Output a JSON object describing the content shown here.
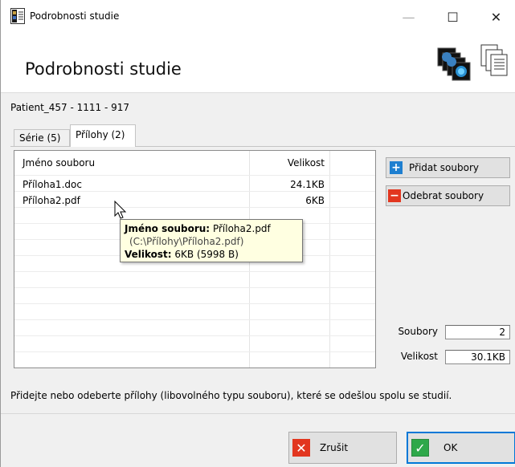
{
  "titlebar": {
    "title": "Podrobnosti studie",
    "minimize_glyph": "—",
    "maximize_glyph": "☐",
    "close_glyph": "✕"
  },
  "header": {
    "title": "Podrobnosti studie",
    "icons": [
      "image-stack-icon",
      "document-stack-icon"
    ]
  },
  "patient_label": "Patient_457 - 1111 - 917",
  "tabs": [
    {
      "label": "Série (5)",
      "active": false
    },
    {
      "label": "Přílohy (2)",
      "active": true
    }
  ],
  "file_table": {
    "columns": [
      "Jméno souboru",
      "Velikost"
    ],
    "rows": [
      {
        "name": "Příloha1.doc",
        "size": "24.1KB"
      },
      {
        "name": "Příloha2.pdf",
        "size": "6KB"
      }
    ]
  },
  "actions": {
    "add_label": "Přidat soubory",
    "remove_label": "Odebrat soubory"
  },
  "summary": {
    "files_label": "Soubory",
    "files_value": "2",
    "size_label": "Velikost",
    "size_value": "30.1KB"
  },
  "hint": "Přidejte nebo odeberte přílohy (libovolného typu souboru), které se odešlou spolu se studií.",
  "dialog": {
    "cancel_label": "Zrušit",
    "ok_label": "OK"
  },
  "tooltip": {
    "name_label": "Jméno souboru:",
    "name_value": "Příloha2.pdf",
    "path": "(C:\\Přílohy\\Příloha2.pdf)",
    "size_label": "Velikost:",
    "size_value": "6KB (5998 B)"
  },
  "colors": {
    "add_icon": "#1e7fd0",
    "remove_icon": "#e2361f",
    "cancel_icon": "#e2361f",
    "ok_icon": "#2ea84a",
    "ok_border": "#0078d7",
    "tooltip_bg": "#ffffe1"
  }
}
